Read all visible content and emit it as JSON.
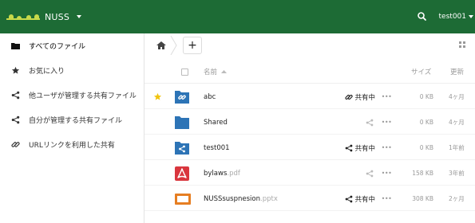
{
  "header": {
    "app_name": "NUSS",
    "user": "test001",
    "colors": {
      "bar": "#1d6b35",
      "logo": "#c7d94a"
    }
  },
  "sidebar": {
    "items": [
      {
        "label": "すべてのファイル",
        "icon": "folder-icon",
        "active": true
      },
      {
        "label": "お気に入り",
        "icon": "star-icon"
      },
      {
        "label": "他ユーザが管理する共有ファイル",
        "icon": "share-icon"
      },
      {
        "label": "自分が管理する共有ファイル",
        "icon": "share-icon"
      },
      {
        "label": "URLリンクを利用した共有",
        "icon": "link-icon"
      }
    ]
  },
  "toolbar": {
    "new_button": "+"
  },
  "table": {
    "columns": {
      "name": "名前",
      "size": "サイズ",
      "modified": "更新"
    },
    "sort": "name-ascending",
    "rows": [
      {
        "favorite": true,
        "type": "shared-folder-link",
        "name": "abc",
        "ext": "",
        "share": "共有中",
        "share_icon": "link-icon",
        "size": "0 KB",
        "modified": "4ヶ月"
      },
      {
        "favorite": false,
        "type": "folder",
        "name": "Shared",
        "ext": "",
        "share": "",
        "share_icon": "share-icon",
        "size": "0 KB",
        "modified": "4ヶ月"
      },
      {
        "favorite": false,
        "type": "shared-folder",
        "name": "test001",
        "ext": "",
        "share": "共有中",
        "share_icon": "share-icon",
        "size": "0 KB",
        "modified": "1年前"
      },
      {
        "favorite": false,
        "type": "pdf",
        "name": "bylaws",
        "ext": ".pdf",
        "share": "",
        "share_icon": "share-icon",
        "size": "158 KB",
        "modified": "3年前"
      },
      {
        "favorite": false,
        "type": "pptx",
        "name": "NUSSsuspnesion",
        "ext": ".pptx",
        "share": "共有中",
        "share_icon": "share-icon",
        "size": "308 KB",
        "modified": "2ヶ月"
      }
    ],
    "more_label": "•••"
  }
}
